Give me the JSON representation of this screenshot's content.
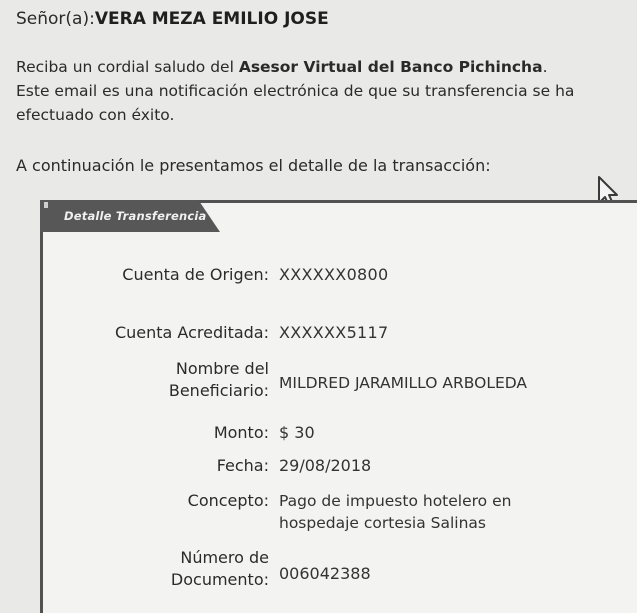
{
  "greeting": {
    "prefix": "Señor(a):",
    "name": "VERA MEZA EMILIO JOSE"
  },
  "intro": {
    "line1_text": "Reciba un cordial saludo del ",
    "line1_bold": "Asesor Virtual del Banco Pichincha",
    "line1_end": ".",
    "line2": "Este email es una notificación electrónica de que su transferencia se ha",
    "line3": "efectuado con éxito."
  },
  "detail_intro": "A continuación le presentamos el detalle de la transacción:",
  "card": {
    "tab_label": "Detalle Transferencia",
    "fields": {
      "origen_label": "Cuenta de Origen:",
      "origen_value": "XXXXXX0800",
      "acreditada_label": "Cuenta Acreditada:",
      "acreditada_value": "XXXXXX5117",
      "beneficiario_label_1": "Nombre del",
      "beneficiario_label_2": "Beneficiario:",
      "beneficiario_value": "MILDRED JARAMILLO ARBOLEDA",
      "monto_label": "Monto:",
      "monto_value": "$ 30",
      "fecha_label": "Fecha:",
      "fecha_value": "29/08/2018",
      "concepto_label": "Concepto:",
      "concepto_value_1": "Pago de impuesto hotelero en",
      "concepto_value_2": "hospedaje cortesia Salinas",
      "documento_label_1": "Número de",
      "documento_label_2": "Documento:",
      "documento_value": "006042388"
    }
  },
  "icons": {
    "cursor": "mouse-pointer-icon"
  }
}
